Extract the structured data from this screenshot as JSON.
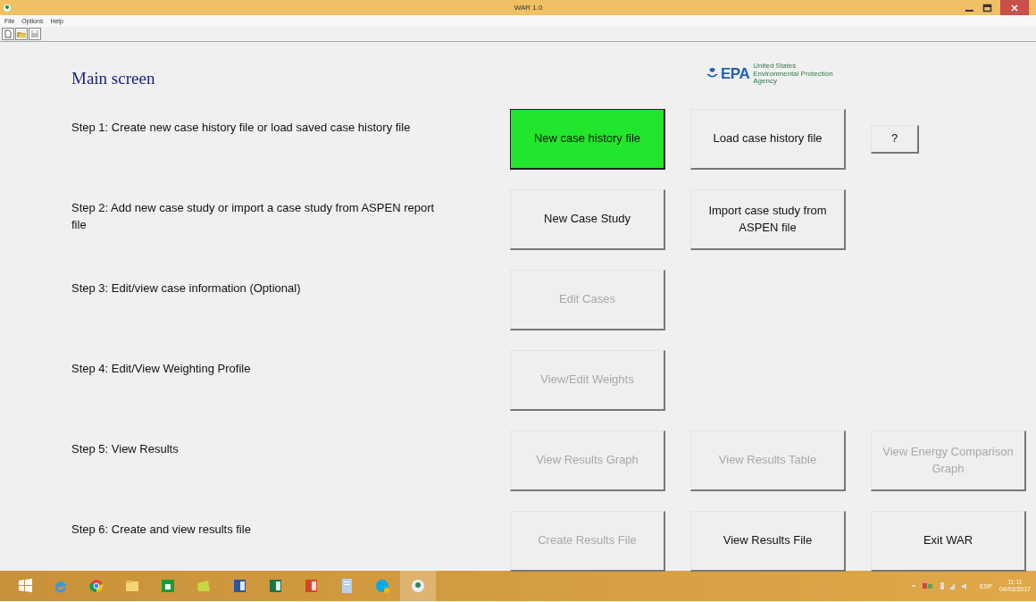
{
  "window": {
    "title": "WAR 1.0"
  },
  "menu": [
    "File",
    "Options",
    "Help"
  ],
  "heading": "Main screen",
  "logo": {
    "mark": "EPA",
    "lines": [
      "United States",
      "Environmental Protection",
      "Agency"
    ]
  },
  "steps": [
    {
      "label": "Step 1: Create new case history file or load saved case history file",
      "buttons": [
        {
          "label": "New case history file",
          "disabled": false,
          "highlighted": true,
          "kind": "large"
        },
        {
          "label": "Load case history file",
          "disabled": false,
          "highlighted": false,
          "kind": "large"
        },
        {
          "label": "?",
          "disabled": false,
          "highlighted": false,
          "kind": "small"
        }
      ]
    },
    {
      "label": "Step 2: Add new case study or import a case study from ASPEN report file",
      "buttons": [
        {
          "label": "New Case Study",
          "disabled": false,
          "highlighted": false,
          "kind": "large"
        },
        {
          "label": "Import case study from ASPEN file",
          "disabled": false,
          "highlighted": false,
          "kind": "large"
        }
      ]
    },
    {
      "label": "Step 3: Edit/view case information (Optional)",
      "buttons": [
        {
          "label": "Edit Cases",
          "disabled": true,
          "highlighted": false,
          "kind": "large"
        }
      ]
    },
    {
      "label": "Step 4: Edit/View Weighting Profile",
      "buttons": [
        {
          "label": "View/Edit Weights",
          "disabled": true,
          "highlighted": false,
          "kind": "large"
        }
      ]
    },
    {
      "label": "Step 5: View Results",
      "buttons": [
        {
          "label": "View Results Graph",
          "disabled": true,
          "highlighted": false,
          "kind": "large"
        },
        {
          "label": "View Results Table",
          "disabled": true,
          "highlighted": false,
          "kind": "large"
        },
        {
          "label": "View Energy Comparison Graph",
          "disabled": true,
          "highlighted": false,
          "kind": "large"
        }
      ]
    },
    {
      "label": "Step 6: Create and view results file",
      "buttons": [
        {
          "label": "Create Results File",
          "disabled": true,
          "highlighted": false,
          "kind": "large"
        },
        {
          "label": "View Results File",
          "disabled": false,
          "highlighted": false,
          "kind": "large"
        },
        {
          "label": "Exit WAR",
          "disabled": false,
          "highlighted": false,
          "kind": "large"
        }
      ]
    }
  ],
  "taskbar": {
    "language": "ESP",
    "time": "11:11",
    "date": "04/03/2017"
  }
}
